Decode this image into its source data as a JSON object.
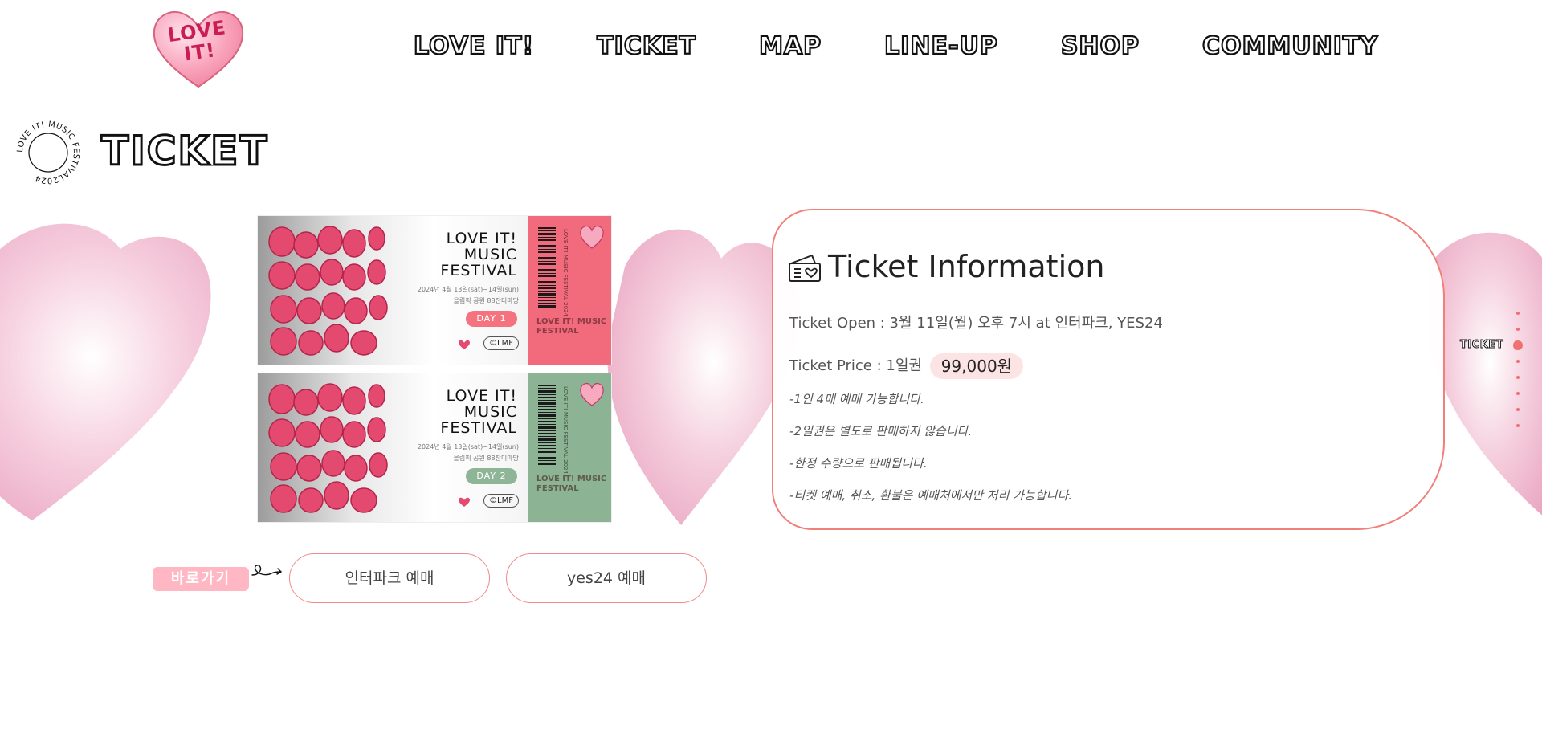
{
  "header": {
    "logo_text": "LOVE IT!",
    "nav": [
      "LOVE IT!",
      "TICKET",
      "MAP",
      "LINE-UP",
      "SHOP",
      "COMMUNITY"
    ]
  },
  "section": {
    "title": "TICKET",
    "badge_text": "LOVE IT! MUSIC FESTIVAL2024 "
  },
  "tickets": [
    {
      "title_line1": "LOVE IT!",
      "title_line2": "MUSIC",
      "title_line3": "FESTIVAL",
      "date": "2024년 4월 13일(sat)~14일(sun)",
      "venue": "올림픽 공원 88잔디마당",
      "day": "DAY 1",
      "brand": "©LMF",
      "stub_text": "LOVE IT! MUSIC FESTIVAL",
      "stub_vertical": "LOVE IT! MUSIC FESTIVAL 2024",
      "color": "#f26b7d",
      "day_color": "#f5737f"
    },
    {
      "title_line1": "LOVE IT!",
      "title_line2": "MUSIC",
      "title_line3": "FESTIVAL",
      "date": "2024년 4월 13일(sat)~14일(sun)",
      "venue": "올림픽 공원 88잔디마당",
      "day": "DAY 2",
      "brand": "©LMF",
      "stub_text": "LOVE IT! MUSIC FESTIVAL",
      "stub_vertical": "LOVE IT! MUSIC FESTIVAL 2024",
      "color": "#8cb494",
      "day_color": "#8fb597"
    }
  ],
  "info": {
    "title": "Ticket Information",
    "open": "Ticket Open : 3월 11일(월) 오후 7시 at 인터파크, YES24",
    "price_label": "Ticket Price : 1일권",
    "price_value": "99,000원",
    "notes": [
      "-1인 4매 예매 가능합니다.",
      "-2일권은 별도로 판매하지 않습니다.",
      "-한정 수량으로 판매됩니다.",
      "-티켓 예매, 취소, 환불은 예매처에서만 처리 가능합니다."
    ]
  },
  "side_nav": {
    "label": "TICKET",
    "sections": 8,
    "active_index": 2
  },
  "shortcuts": {
    "label": "바로가기",
    "buttons": [
      "인터파크 예매",
      "yes24 예매"
    ]
  },
  "colors": {
    "accent": "#f0807a",
    "pink_light": "#ffb7c3",
    "price_bg": "#fde4e4"
  }
}
